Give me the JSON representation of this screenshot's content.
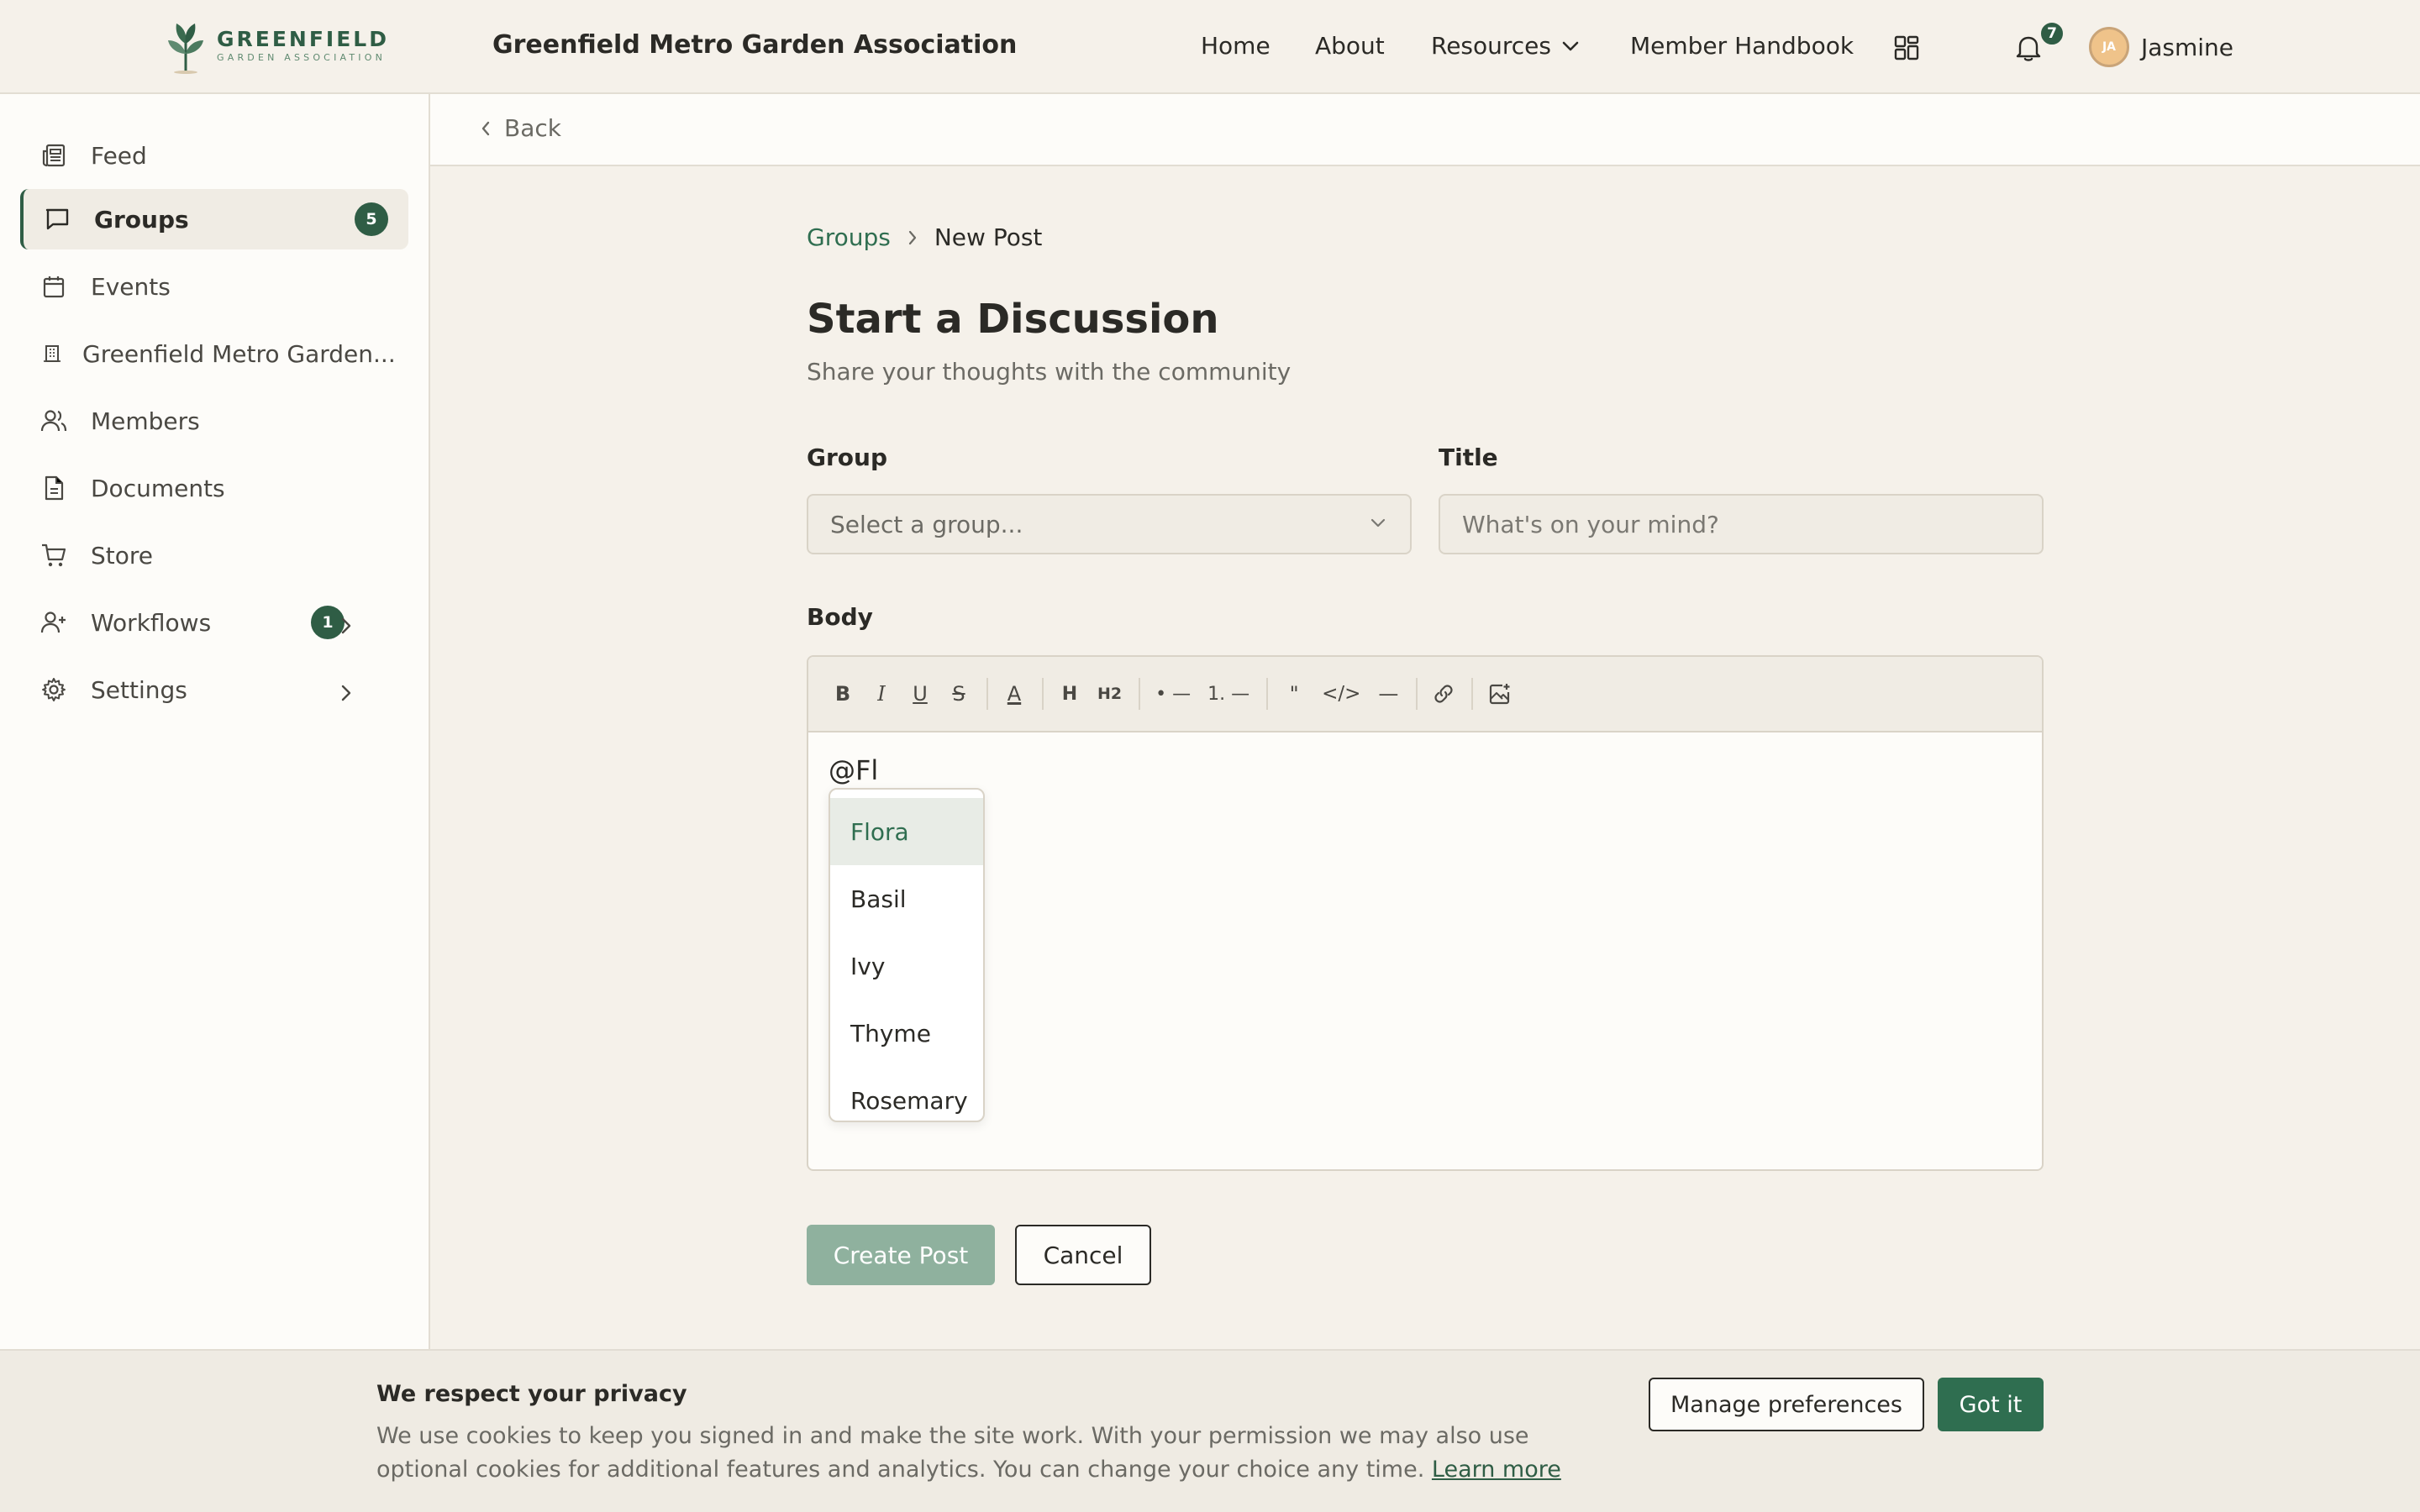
{
  "header": {
    "logo_name": "GREENFIELD",
    "logo_sub": "GARDEN ASSOCIATION",
    "site_title": "Greenfield Metro Garden Association",
    "nav": {
      "home": "Home",
      "about": "About",
      "resources": "Resources",
      "handbook": "Member Handbook"
    },
    "notification_count": "7",
    "user": {
      "initials": "JA",
      "name": "Jasmine"
    },
    "icons": [
      "apps-grid-icon",
      "bell-icon",
      "chevron-down-icon"
    ]
  },
  "sidebar": {
    "items": [
      {
        "label": "Feed",
        "icon": "newspaper-icon"
      },
      {
        "label": "Groups",
        "icon": "chat-bubble-icon",
        "badge": "5",
        "active": true
      },
      {
        "label": "Events",
        "icon": "calendar-icon"
      },
      {
        "label": "Greenfield Metro Garden...",
        "icon": "building-icon"
      },
      {
        "label": "Members",
        "icon": "users-icon"
      },
      {
        "label": "Documents",
        "icon": "document-icon"
      },
      {
        "label": "Store",
        "icon": "cart-icon"
      },
      {
        "label": "Workflows",
        "icon": "user-plus-icon",
        "badge": "1"
      },
      {
        "label": "Settings",
        "icon": "gear-icon"
      }
    ]
  },
  "main": {
    "back": "Back",
    "breadcrumb": {
      "parent": "Groups",
      "current": "New Post"
    },
    "title": "Start a Discussion",
    "subtitle": "Share your thoughts with the community",
    "form": {
      "group_label": "Group",
      "group_placeholder": "Select a group...",
      "title_label": "Title",
      "title_placeholder": "What's on your mind?",
      "body_label": "Body",
      "body_text": "@Fl",
      "toolbar": {
        "bold": "B",
        "italic": "I",
        "underline": "U",
        "strike": "S",
        "color": "A",
        "h1": "H",
        "h2": "H2",
        "bullet": "• —",
        "ordered": "1. —",
        "quote": "\"",
        "code": "</>",
        "hr": "—"
      }
    },
    "mention_options": [
      "Flora",
      "Basil",
      "Ivy",
      "Thyme",
      "Rosemary"
    ],
    "create_label": "Create Post",
    "cancel_label": "Cancel"
  },
  "cookie": {
    "title": "We respect your privacy",
    "body": "We use cookies to keep you signed in and make the site work. With your permission we may also use optional cookies for additional features and analytics. You can change your choice any time.",
    "link": "Learn more",
    "manage": "Manage preferences",
    "accept": "Got it"
  },
  "colors": {
    "brand": "#2f5d45",
    "link": "#2f6e50",
    "background": "#f5f1ea",
    "surface": "#fdfcf9",
    "primary_disabled": "#8fb19e"
  }
}
